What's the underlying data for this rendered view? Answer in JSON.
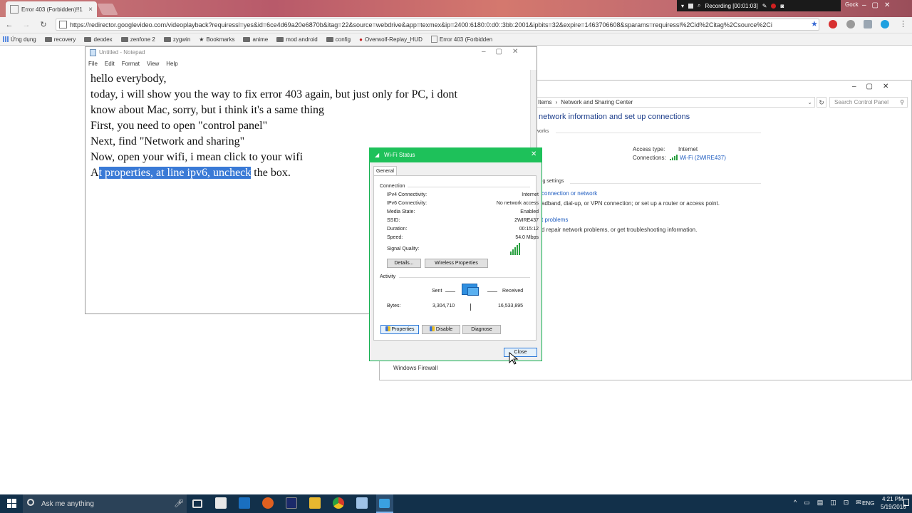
{
  "browser": {
    "tab_title": "Error 403 (Forbidden)!!1",
    "tab_close": "×",
    "url_scheme": "https://",
    "url_rest": "redirector.googlevideo.com/videoplayback?requiressl=yes&id=6ce4d69a20e6870b&itag=22&source=webdrive&app=texmex&ip=2400:6180:0:d0::3bb:2001&ipbits=32&expire=1463706608&sparams=requiressl%2Cid%2Citag%2Csource%2Ci",
    "bookmarks": [
      "Ứng dụng",
      "recovery",
      "deodex",
      "zenfone 2",
      "zygwin",
      "Bookmarks",
      "anime",
      "mod android",
      "config",
      "Overwolf-Replay_HUD",
      "Error 403 (Forbidden"
    ],
    "recording": "Recording [00:01:03]",
    "user": "Gock"
  },
  "notepad": {
    "title": "Untitled - Notepad",
    "menu": [
      "File",
      "Edit",
      "Format",
      "View",
      "Help"
    ],
    "lines": [
      "hello everybody,",
      "today, i will show you the way to fix error 403 again, but just only for PC, i dont",
      "know about Mac, sorry, but i think it's a same thing",
      "First, you need to open \"control panel\"",
      "Next, find \"Network and sharing\"",
      "Now, open your wifi, i mean click to your wifi"
    ],
    "last_line_pre": "A",
    "last_line_selected": "t properties, at line ipv6, uncheck",
    "last_line_post": " the box."
  },
  "control_panel": {
    "breadcrumb_items": "Items",
    "breadcrumb_sep": "›",
    "breadcrumb_current": "Network and Sharing Center",
    "search_placeholder": "Search Control Panel",
    "heading": "network information and set up connections",
    "networks_label": "works",
    "access_type_label": "Access type:",
    "access_type_value": "Internet",
    "connections_label": "Connections:",
    "connections_value": "Wi-Fi (2WIRE437)",
    "change_settings": "ing settings",
    "new_connection": "connection or network",
    "new_connection_desc": "adband, dial-up, or VPN connection; or set up a router or access point.",
    "troubleshoot": "t problems",
    "troubleshoot_desc": "d repair network problems, or get troubleshooting information.",
    "firewall": "Windows Firewall"
  },
  "wifi_status": {
    "title": "Wi-Fi Status",
    "tab": "General",
    "connection_section": "Connection",
    "rows": [
      {
        "label": "IPv4 Connectivity:",
        "value": "Internet"
      },
      {
        "label": "IPv6 Connectivity:",
        "value": "No network access"
      },
      {
        "label": "Media State:",
        "value": "Enabled"
      },
      {
        "label": "SSID:",
        "value": "2WIRE437"
      },
      {
        "label": "Duration:",
        "value": "00:15:12"
      },
      {
        "label": "Speed:",
        "value": "54.0 Mbps"
      }
    ],
    "signal_label": "Signal Quality:",
    "signal_level": 5,
    "details_btn": "Details...",
    "wireless_props_btn": "Wireless Properties",
    "activity_section": "Activity",
    "sent_label": "Sent",
    "received_label": "Received",
    "bytes_label": "Bytes:",
    "bytes_sent": "3,304,710",
    "bytes_received": "16,533,895",
    "properties_btn": "Properties",
    "disable_btn": "Disable",
    "diagnose_btn": "Diagnose",
    "close_btn": "Close"
  },
  "taskbar": {
    "search_placeholder": "Ask me anything",
    "language": "ENG",
    "time": "4:21 PM",
    "date": "5/19/2016"
  }
}
